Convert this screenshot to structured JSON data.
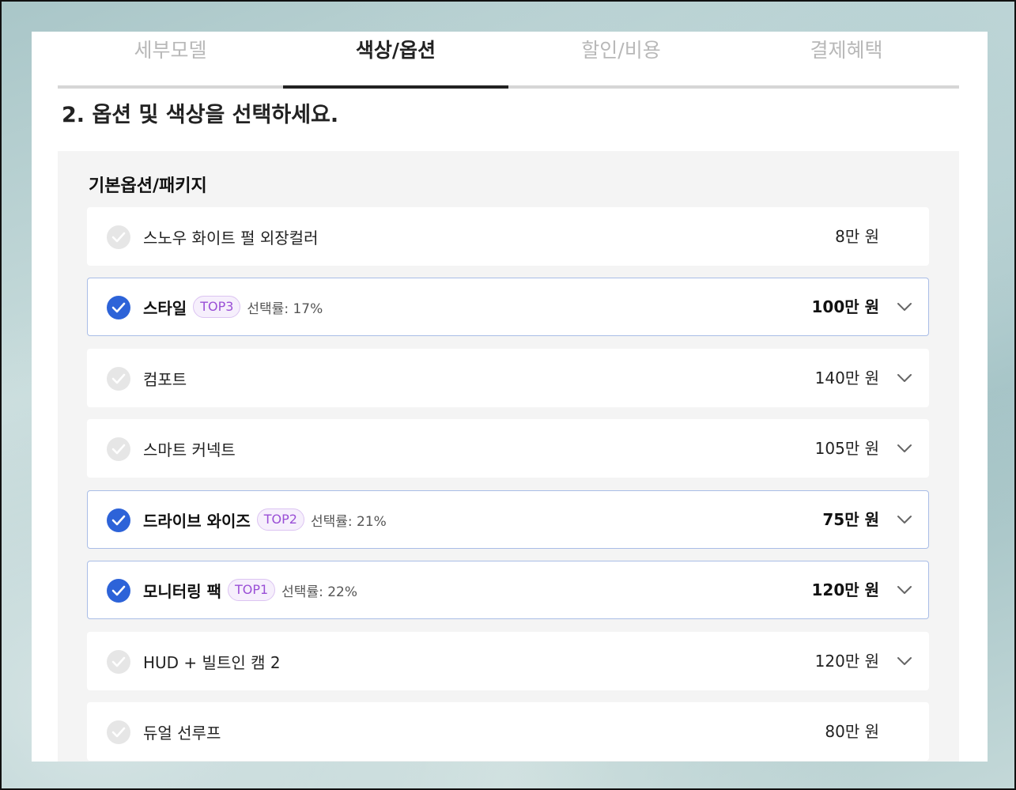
{
  "tabs": [
    {
      "label": "세부모델",
      "active": false
    },
    {
      "label": "색상/옵션",
      "active": true
    },
    {
      "label": "할인/비용",
      "active": false
    },
    {
      "label": "결제혜택",
      "active": false
    }
  ],
  "page_title": "2. 옵션 및 색상을 선택하세요.",
  "section_title": "기본옵션/패키지",
  "options": [
    {
      "name": "스노우 화이트 펄 외장컬러",
      "price": "8만 원",
      "selected": false,
      "badge": "",
      "rate": "",
      "expandable": false
    },
    {
      "name": "스타일",
      "price": "100만 원",
      "selected": true,
      "badge": "TOP3",
      "rate": "선택률: 17%",
      "expandable": true
    },
    {
      "name": "컴포트",
      "price": "140만 원",
      "selected": false,
      "badge": "",
      "rate": "",
      "expandable": true
    },
    {
      "name": "스마트 커넥트",
      "price": "105만 원",
      "selected": false,
      "badge": "",
      "rate": "",
      "expandable": true
    },
    {
      "name": "드라이브 와이즈",
      "price": "75만 원",
      "selected": true,
      "badge": "TOP2",
      "rate": "선택률: 21%",
      "expandable": true
    },
    {
      "name": "모니터링 팩",
      "price": "120만 원",
      "selected": true,
      "badge": "TOP1",
      "rate": "선택률: 22%",
      "expandable": true
    },
    {
      "name": "HUD + 빌트인 캠 2",
      "price": "120만 원",
      "selected": false,
      "badge": "",
      "rate": "",
      "expandable": true
    },
    {
      "name": "듀얼 선루프",
      "price": "80만 원",
      "selected": false,
      "badge": "",
      "rate": "",
      "expandable": false
    }
  ],
  "colors": {
    "accent": "#2d63d8",
    "selected_border": "#a9bde6",
    "badge_text": "#9a4fd6"
  }
}
